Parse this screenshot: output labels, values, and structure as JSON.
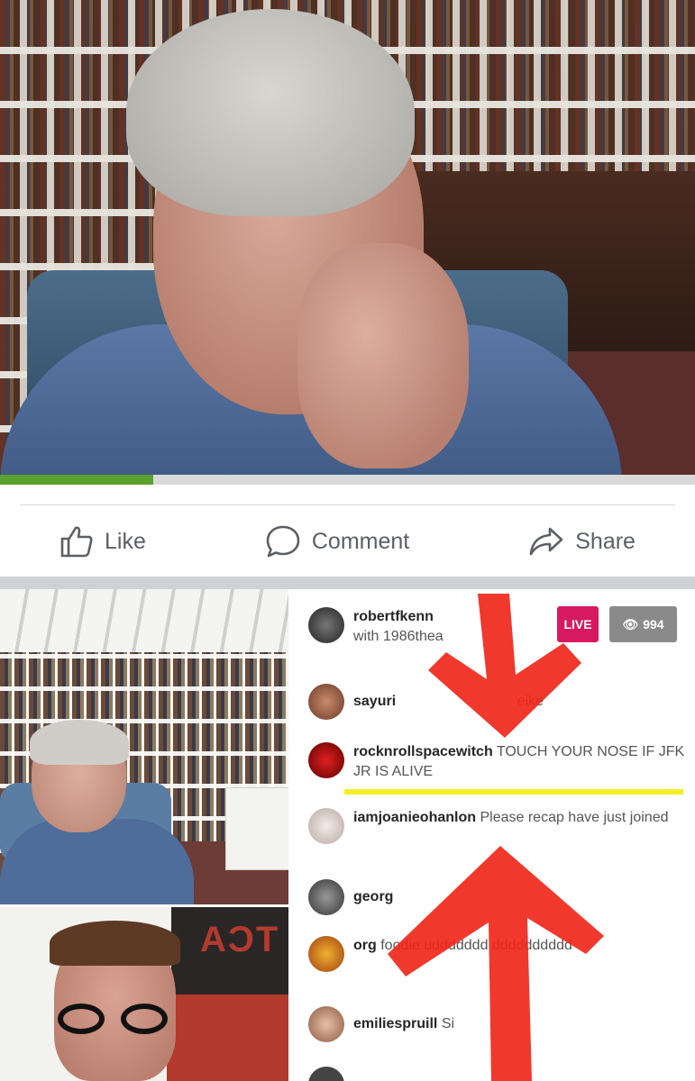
{
  "video": {
    "progress_fraction": 0.22
  },
  "actions": {
    "like_label": "Like",
    "comment_label": "Comment",
    "share_label": "Share"
  },
  "embedded_screenshot": {
    "sign_text": "TCA",
    "live_badge": "LIVE",
    "viewer_count": "994",
    "comments": [
      {
        "user": "robertfkenn",
        "text": "with 1986thea"
      },
      {
        "user": "sayuri",
        "text": "eike"
      },
      {
        "user": "rocknrollspacewitch",
        "text": "TOUCH YOUR NOSE IF JFK JR IS ALIVE"
      },
      {
        "user": "iamjoanieohanlon",
        "text": "Please recap have just joined"
      },
      {
        "user": "georg",
        "text": ""
      },
      {
        "user": "org",
        "text": "foodie  uddddddd dddddddddd"
      },
      {
        "user": "emiliespruill",
        "text": "Si"
      }
    ]
  },
  "colors": {
    "like_gray": "#5b5f66",
    "progress_green": "#5aa02c",
    "live_pink": "#d7195f",
    "highlight_yellow": "#f3ee28",
    "arrow_red": "#f0271b"
  }
}
